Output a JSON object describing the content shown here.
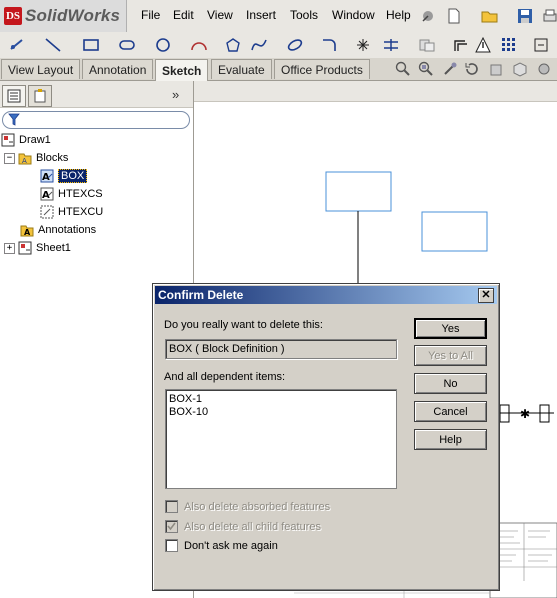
{
  "app": {
    "name": "SolidWorks",
    "logo_mark": "DS"
  },
  "menu": [
    "File",
    "Edit",
    "View",
    "Insert",
    "Tools",
    "Window",
    "Help"
  ],
  "command_tabs": [
    {
      "label": "View Layout",
      "active": false
    },
    {
      "label": "Annotation",
      "active": false
    },
    {
      "label": "Sketch",
      "active": true
    },
    {
      "label": "Evaluate",
      "active": false
    },
    {
      "label": "Office Products",
      "active": false
    }
  ],
  "panel": {
    "collapse_glyph": "»",
    "tree": {
      "root": "Draw1",
      "blocks": "Blocks",
      "block_items": [
        "BOX",
        "HTEXCS",
        "HTEXCU"
      ],
      "selected_item": "BOX",
      "annotations": "Annotations",
      "sheet": "Sheet1"
    }
  },
  "dialog": {
    "title": "Confirm Delete",
    "close_glyph": "✕",
    "question": "Do you really want to delete this:",
    "target": "BOX ( Block Definition )",
    "dependents_label": "And all dependent items:",
    "dependents": [
      "BOX-1",
      "BOX-10"
    ],
    "buttons": {
      "yes": "Yes",
      "yes_to_all": "Yes to All",
      "no": "No",
      "cancel": "Cancel",
      "help": "Help"
    },
    "options": [
      {
        "label": "Also delete absorbed features",
        "checked": false,
        "enabled": false
      },
      {
        "label": "Also delete all child features",
        "checked": true,
        "enabled": false
      },
      {
        "label": "Don't ask me again",
        "checked": false,
        "enabled": true
      }
    ]
  },
  "colors": {
    "title_gradient_start": "#0a246a",
    "title_gradient_end": "#a6caf0",
    "sketch_blue": "#4a90d9",
    "brand_red": "#c4161c"
  }
}
